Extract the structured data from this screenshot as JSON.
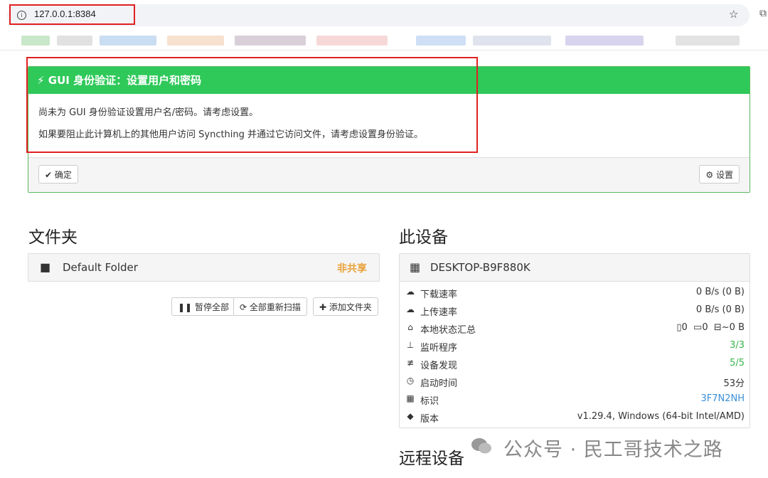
{
  "browser": {
    "url": "127.0.0.1:8384"
  },
  "alert": {
    "title": "GUI 身份验证：设置用户和密码",
    "line1": "尚未为 GUI 身份验证设置用户名/密码。请考虑设置。",
    "line2": "如果要阻止此计算机上的其他用户访问 Syncthing 并通过它访问文件，请考虑设置身份验证。",
    "ok_label": "确定",
    "settings_label": "设置"
  },
  "folders": {
    "heading": "文件夹",
    "items": [
      {
        "name": "Default Folder",
        "status": "非共享"
      }
    ],
    "actions": {
      "pause_all": "暂停全部",
      "rescan_all": "全部重新扫描",
      "add_folder": "添加文件夹"
    }
  },
  "this_device": {
    "heading": "此设备",
    "name": "DESKTOP-B9F880K",
    "rows": [
      {
        "label": "下载速率",
        "value": "0 B/s (0 B)"
      },
      {
        "label": "上传速率",
        "value": "0 B/s (0 B)"
      },
      {
        "label": "本地状态汇总",
        "files": "0",
        "dirs": "0",
        "size": "~0 B"
      },
      {
        "label": "监听程序",
        "value": "3/3"
      },
      {
        "label": "设备发现",
        "value": "5/5"
      },
      {
        "label": "启动时间",
        "value": "53分"
      },
      {
        "label": "标识",
        "value": "3F7N2NH"
      },
      {
        "label": "版本",
        "value": "v1.29.4, Windows (64-bit Intel/AMD)"
      }
    ]
  },
  "remote_devices": {
    "heading": "远程设备"
  },
  "watermark": {
    "text": "公众号 · 民工哥技术之路"
  },
  "colors": {
    "alert_header": "#2fc95a",
    "not_shared": "#e8a23a",
    "ok_green": "#3ab54a",
    "id_blue": "#3a8fd6",
    "annotation_red": "#e02020"
  }
}
